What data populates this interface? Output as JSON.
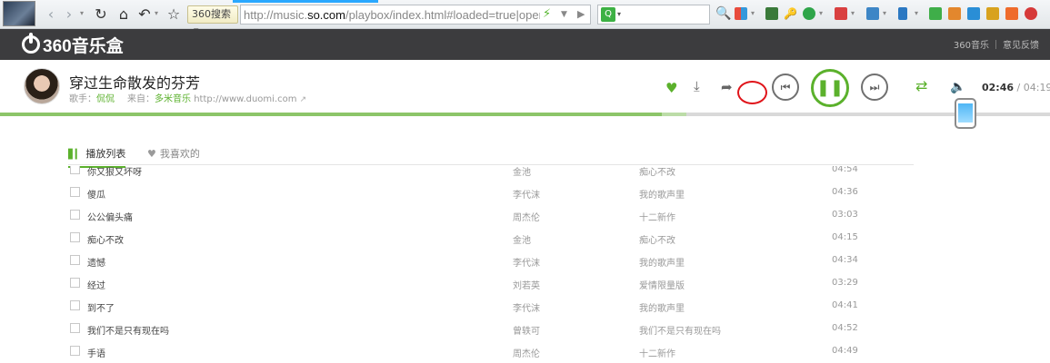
{
  "browser": {
    "search_engine": "360搜索",
    "url_prefix": "http://music.",
    "url_host": "so.com",
    "url_suffix": "/playbox/index.html#loaded=true|opener"
  },
  "header": {
    "logo_text": "360音乐盒",
    "links": [
      "360音乐",
      "意见反馈"
    ]
  },
  "player": {
    "song_title": "穿过生命散发的芬芳",
    "singer_label": "歌手：",
    "singer": "侃侃",
    "source_label": "来自：",
    "source": "多米音乐",
    "source_url": "http://www.duomi.com",
    "current_time": "02:46",
    "time_separator": "/",
    "total_time": "04:19",
    "progress": 0.633
  },
  "tabs": {
    "playlist": "播放列表",
    "favorites": "我喜欢的"
  },
  "colors": {
    "accent": "#5bb12c",
    "header_bg": "#3c3c3e",
    "annotation": "#e0141a"
  },
  "songs": [
    {
      "name": "你又狠又坏呀",
      "artist": "金池",
      "album": "痴心不改",
      "duration": "04:54"
    },
    {
      "name": "傻瓜",
      "artist": "李代沫",
      "album": "我的歌声里",
      "duration": "04:36"
    },
    {
      "name": "公公偏头痛",
      "artist": "周杰伦",
      "album": "十二新作",
      "duration": "03:03"
    },
    {
      "name": "痴心不改",
      "artist": "金池",
      "album": "痴心不改",
      "duration": "04:15"
    },
    {
      "name": "遗憾",
      "artist": "李代沫",
      "album": "我的歌声里",
      "duration": "04:34"
    },
    {
      "name": "经过",
      "artist": "刘若英",
      "album": "爱情限量版",
      "duration": "03:29"
    },
    {
      "name": "到不了",
      "artist": "李代沫",
      "album": "我的歌声里",
      "duration": "04:41"
    },
    {
      "name": "我们不是只有现在吗",
      "artist": "曾轶可",
      "album": "我们不是只有现在吗",
      "duration": "04:52"
    },
    {
      "name": "手语",
      "artist": "周杰伦",
      "album": "十二新作",
      "duration": "04:49"
    }
  ]
}
